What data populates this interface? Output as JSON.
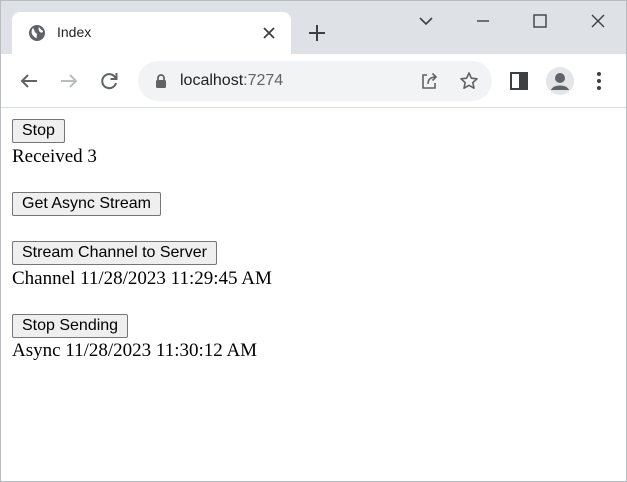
{
  "browser": {
    "tab": {
      "title": "Index",
      "icon": "globe-icon"
    },
    "new_tab_label": "+",
    "address": {
      "host": "localhost",
      "port": ":7274"
    }
  },
  "page": {
    "stop_button": "Stop",
    "received_text": "Received 3",
    "get_async_stream_button": "Get Async Stream",
    "stream_channel_button": "Stream Channel to Server",
    "channel_text": "Channel 11/28/2023 11:29:45 AM",
    "stop_sending_button": "Stop Sending",
    "async_text": "Async 11/28/2023 11:30:12 AM"
  },
  "colors": {
    "tabstrip_bg": "#dee1e6",
    "omnibox_bg": "#f1f3f4",
    "button_bg": "#efefef"
  }
}
